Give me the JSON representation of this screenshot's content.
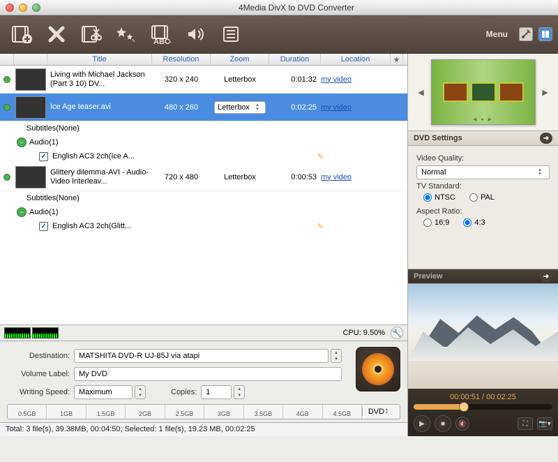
{
  "window": {
    "title": "4Media DivX to DVD Converter"
  },
  "toolbar": {
    "menu_label": "Menu"
  },
  "columns": {
    "title": "Title",
    "resolution": "Resolution",
    "zoom": "Zoom",
    "duration": "Duration",
    "location": "Location",
    "star": "★"
  },
  "files": [
    {
      "title": "Living with Michael Jackson (Part 3 10) DV...",
      "resolution": "320 x 240",
      "zoom": "Letterbox",
      "duration": "0:01:32",
      "location": "my video",
      "subtitles": "Subtitles(None)",
      "audio_header": "Audio(1)",
      "audio_track": "English AC3 2ch(Ice A..."
    },
    {
      "title": "Ice Age teaser.avi",
      "resolution": "480 x 260",
      "zoom": "Letterbox",
      "duration": "0:02:25",
      "location": "my video"
    },
    {
      "title": "Glittery dilemma-AVI - Audio-Video Interleav...",
      "resolution": "720 x 480",
      "zoom": "Letterbox",
      "duration": "0:00:53",
      "location": "my video",
      "subtitles": "Subtitles(None)",
      "audio_header": "Audio(1)",
      "audio_track": "English AC3 2ch(Glitt..."
    }
  ],
  "cpu": {
    "label": "CPU: 9.50%"
  },
  "form": {
    "destination_label": "Destination:",
    "destination_value": "MATSHITA DVD-R UJ-85J via atapi",
    "volume_label": "Volume Label:",
    "volume_value": "My DVD",
    "speed_label": "Writing Speed:",
    "speed_value": "Maximum",
    "copies_label": "Copies:",
    "copies_value": "1"
  },
  "sizebar": {
    "ticks": [
      "0.5GB",
      "1GB",
      "1.5GB",
      "2GB",
      "2.5GB",
      "3GB",
      "3.5GB",
      "4GB",
      "4.5GB"
    ],
    "dvd_label": "DVD"
  },
  "status": "Total: 3 file(s), 39.38MB,  00:04:50; Selected: 1 file(s), 19.23 MB,  00:02:25",
  "settings": {
    "header": "DVD Settings",
    "quality_label": "Video Quality:",
    "quality_value": "Normal",
    "tv_label": "TV Standard:",
    "tv_ntsc": "NTSC",
    "tv_pal": "PAL",
    "aspect_label": "Aspect Ratio:",
    "aspect_169": "16:9",
    "aspect_43": "4:3"
  },
  "preview": {
    "header": "Preview",
    "time": "00:00:51 / 00:02:25"
  }
}
